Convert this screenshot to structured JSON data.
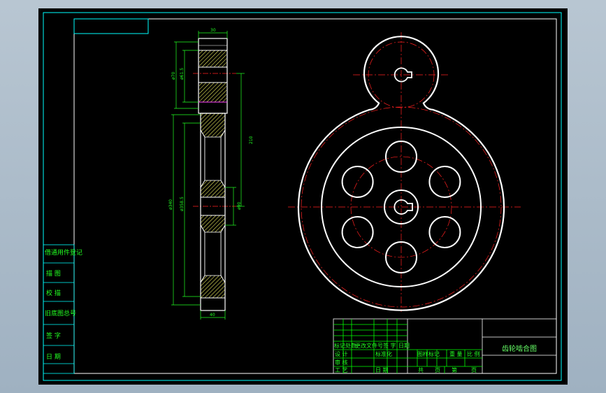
{
  "drawing": {
    "title": "齿轮啮合图",
    "colors": {
      "background": "#000000",
      "frame": "#00ffff",
      "geometry": "#ffffff",
      "centerline": "#ff2020",
      "dimension": "#22ff22",
      "hatch": "#ffff66"
    }
  },
  "side_panel": {
    "rows": [
      "借通用件登记",
      "描 图",
      "校 描",
      "旧底图总号",
      "签 字",
      "日 期"
    ]
  },
  "title_block": {
    "row_labels": [
      "标记处数",
      "更改文件号",
      "签 字",
      "日期"
    ],
    "design": "设 计",
    "standard": "标准化",
    "review": "审 核",
    "process": "工 艺",
    "date": "日 期",
    "stage_mark": "图样标记",
    "weight": "重 量",
    "scale": "比 例",
    "sheet_total": "共",
    "sheet_total_unit": "页",
    "sheet_no": "第",
    "sheet_no_unit": "页"
  },
  "dimensions": {
    "top_width": "30",
    "d_pinion_outer": "ø70",
    "d_pinion_pitch": "ø61.5",
    "center_distance": "210",
    "d_gear_outer": "ø340",
    "d_gear_pitch": "ø358.5",
    "d_hub": "ø90",
    "bottom_width": "40"
  }
}
